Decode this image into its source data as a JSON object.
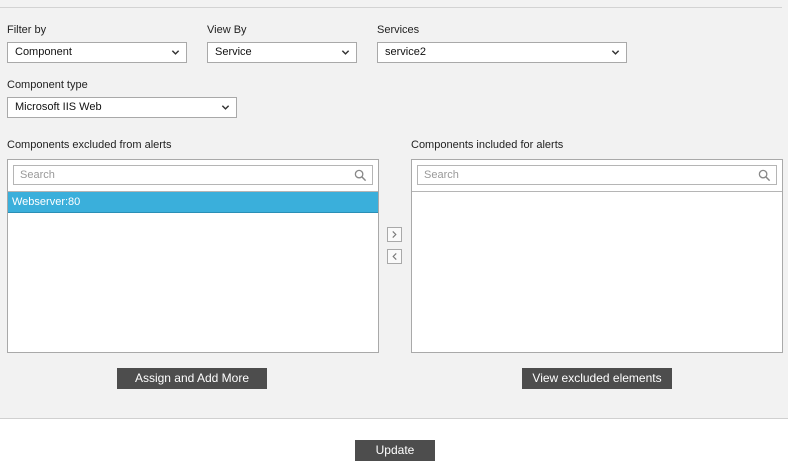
{
  "filters": {
    "filter_by": {
      "label": "Filter by",
      "value": "Component"
    },
    "view_by": {
      "label": "View By",
      "value": "Service"
    },
    "services": {
      "label": "Services",
      "value": "service2"
    },
    "component_type": {
      "label": "Component type",
      "value": "Microsoft IIS Web"
    }
  },
  "excluded": {
    "title": "Components excluded from alerts",
    "search_placeholder": "Search",
    "items": [
      "Webserver:80"
    ]
  },
  "included": {
    "title": "Components included for alerts",
    "search_placeholder": "Search",
    "items": []
  },
  "buttons": {
    "assign": "Assign and Add More",
    "view_excluded": "View excluded elements",
    "update": "Update"
  },
  "icons": {
    "select_chevron": "chevron-down-icon",
    "search": "search-icon",
    "move_right": "chevron-right-icon",
    "move_left": "chevron-left-icon"
  },
  "colors": {
    "selected_item": "#3aafdb",
    "button_bg": "#4d4d4d",
    "panel_bg": "#f2f2f2"
  }
}
